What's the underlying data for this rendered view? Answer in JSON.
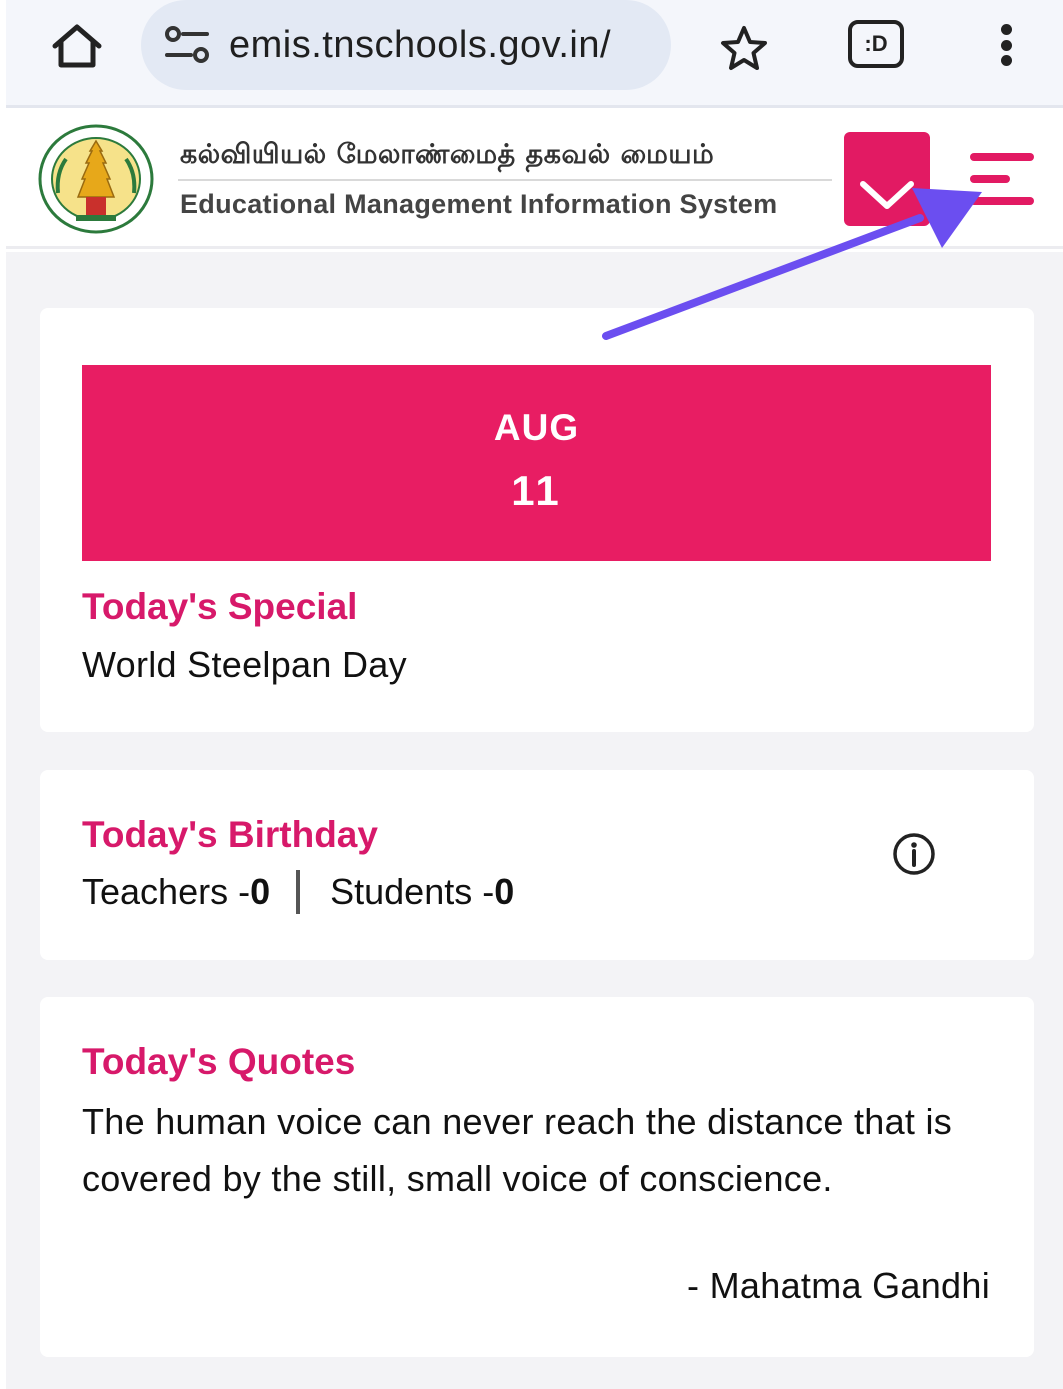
{
  "browser": {
    "url": "emis.tnschools.gov.in/",
    "tab_badge": ":D"
  },
  "header": {
    "title_tamil": "கல்வியியல் மேலாண்மைத் தகவல் மையம்",
    "title_english": "Educational Management Information System"
  },
  "special_card": {
    "month": "AUG",
    "day": "11",
    "heading": "Today's Special",
    "text": "World Steelpan Day"
  },
  "birthday_card": {
    "heading": "Today's Birthday",
    "teachers_label": "Teachers - ",
    "teachers_count": "0",
    "students_label": "Students - ",
    "students_count": "0"
  },
  "quotes_card": {
    "heading": "Today's Quotes",
    "quote": "The human voice can never reach the distance that is covered by the still, small voice of conscience.",
    "author": "- Mahatma Gandhi"
  },
  "colors": {
    "brand_pink": "#e81d63",
    "heading_pink": "#d7196a",
    "annotation_arrow": "#6b4ef0"
  },
  "icons": [
    "home-icon",
    "site-settings-icon",
    "star-icon",
    "tab-switcher-icon",
    "more-vert-icon",
    "emblem-logo",
    "chevron-down-icon",
    "menu-icon",
    "info-icon"
  ]
}
